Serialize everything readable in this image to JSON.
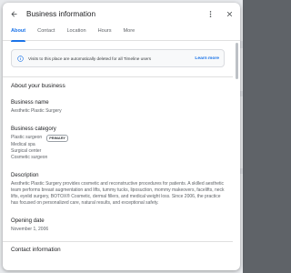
{
  "dialog": {
    "title": "Business information"
  },
  "tabs": [
    {
      "label": "About"
    },
    {
      "label": "Contact"
    },
    {
      "label": "Location"
    },
    {
      "label": "Hours"
    },
    {
      "label": "More"
    }
  ],
  "notice": {
    "text": "Visits to this place are automatically deleted for all Timeline users",
    "link": "Learn more"
  },
  "about": {
    "section_title": "About your business",
    "business_name": {
      "label": "Business name",
      "value": "Aesthetic Plastic Surgery"
    },
    "business_category": {
      "label": "Business category",
      "primary": "Plastic surgeon",
      "primary_badge": "PRIMARY",
      "others": [
        "Medical spa",
        "Surgical center",
        "Cosmetic surgeon"
      ]
    },
    "description": {
      "label": "Description",
      "value": "Aesthetic Plastic Surgery provides cosmetic and reconstructive procedures for patients. A skilled aesthetic team performs breast augmentation and lifts, tummy tucks, liposuction, mommy makeovers, facelifts, neck lifts, eyelid surgery, BOTOX® Cosmetic, dermal fillers, and medical weight loss. Since 2006, the practice has focused on personalized care, natural results, and exceptional safety."
    },
    "opening_date": {
      "label": "Opening date",
      "value": "November 1, 2006"
    },
    "contact_info": {
      "label": "Contact information"
    }
  },
  "icons": {
    "back": "back-arrow-icon",
    "more": "more-vert-icon",
    "close": "close-icon",
    "info": "info-icon"
  },
  "colors": {
    "accent": "#1a73e8",
    "text": "#202124",
    "secondary_text": "#5f6368"
  }
}
